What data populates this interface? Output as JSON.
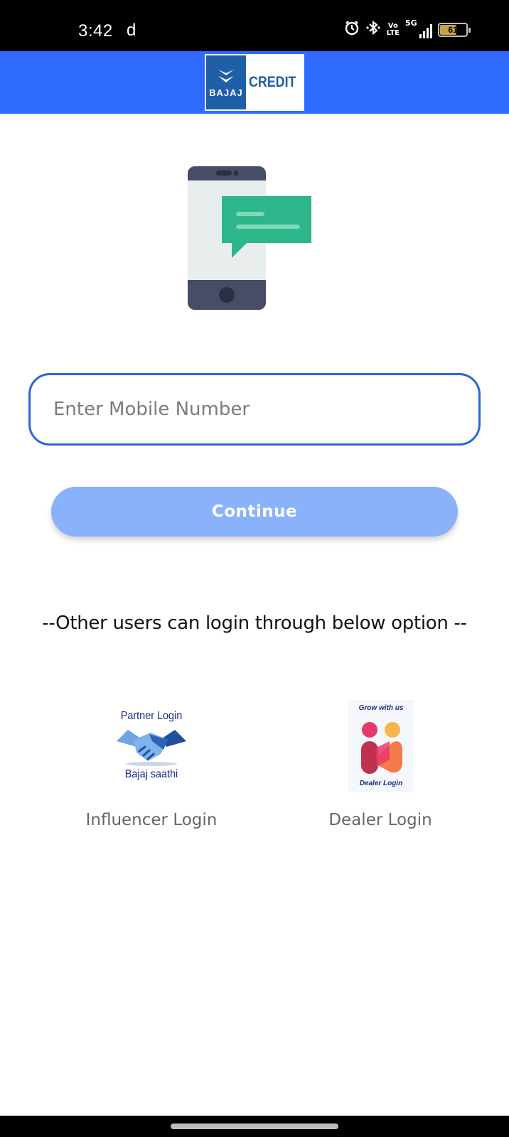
{
  "status_bar": {
    "time": "3:42",
    "notification_letter": "d",
    "volte_top": "Vo",
    "volte_bottom": "LTE",
    "network": "5G",
    "battery": "61",
    "icons": [
      "alarm-icon",
      "bluetooth-icon",
      "volte-icon",
      "signal-icon",
      "battery-icon"
    ]
  },
  "header": {
    "brand": "BAJAJ",
    "product": "CREDIT",
    "bar_color": "#2f6bff"
  },
  "form": {
    "mobile_placeholder": "Enter Mobile Number",
    "mobile_value": "",
    "continue_label": "Continue",
    "button_color": "#8ab2fb",
    "field_border_color": "#2a67d8"
  },
  "other_users": {
    "text": "--Other users can login through below option --"
  },
  "login_options": [
    {
      "image_top_text": "Partner Login",
      "image_bottom_text": "Bajaj saathi",
      "label": "Influencer Login"
    },
    {
      "image_top_text": "Grow with us",
      "image_bottom_text": "Dealer Login",
      "label": "Dealer Login"
    }
  ]
}
